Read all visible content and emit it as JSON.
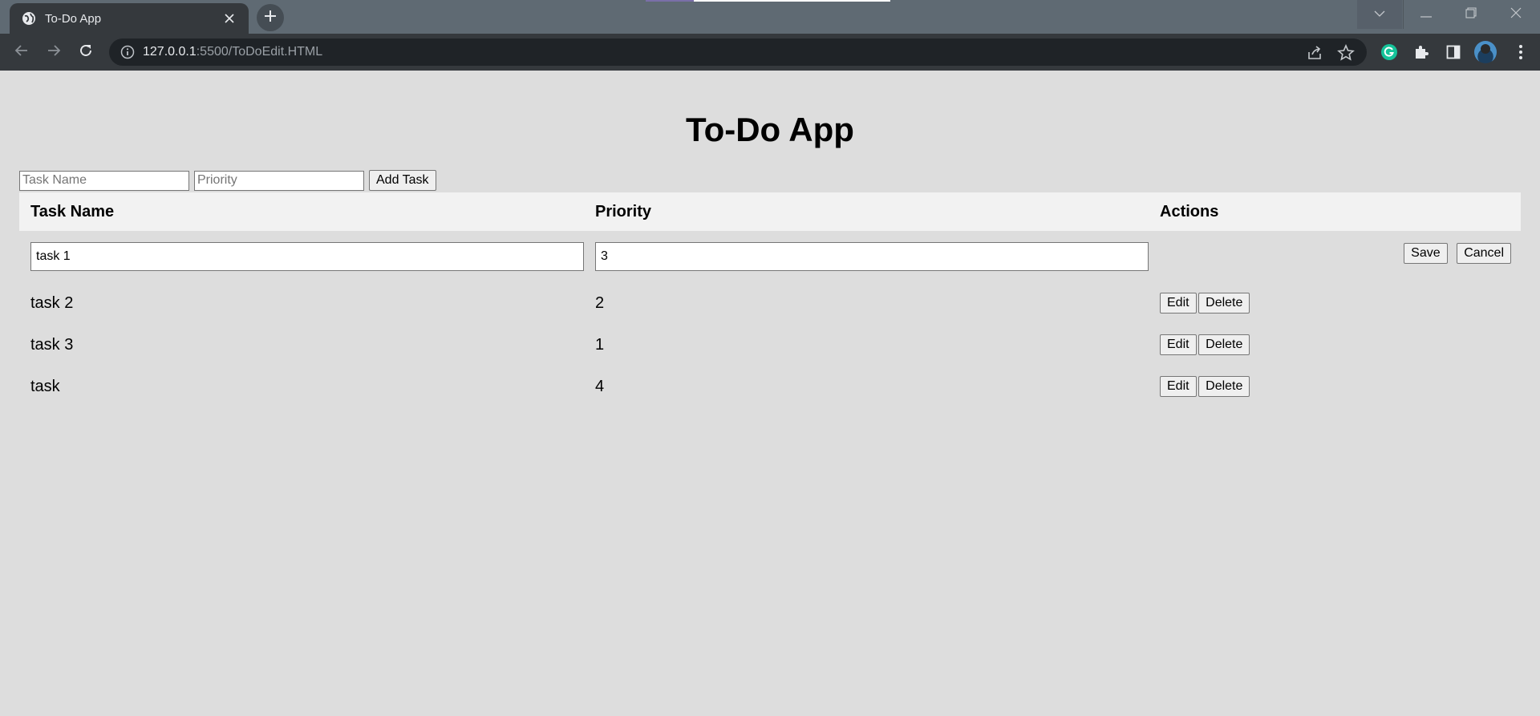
{
  "browser": {
    "tab_title": "To-Do App",
    "url_host": "127.0.0.1",
    "url_rest": ":5500/ToDoEdit.HTML"
  },
  "app": {
    "title": "To-Do App",
    "form": {
      "task_placeholder": "Task Name",
      "priority_placeholder": "Priority",
      "add_label": "Add Task"
    },
    "table": {
      "headers": [
        "Task Name",
        "Priority",
        "Actions"
      ],
      "edit_row": {
        "task_value": "task 1",
        "priority_value": "3",
        "save_label": "Save",
        "cancel_label": "Cancel"
      },
      "rows": [
        {
          "task": "task 2",
          "priority": "2",
          "edit_label": "Edit",
          "delete_label": "Delete"
        },
        {
          "task": "task 3",
          "priority": "1",
          "edit_label": "Edit",
          "delete_label": "Delete"
        },
        {
          "task": "task",
          "priority": "4",
          "edit_label": "Edit",
          "delete_label": "Delete"
        }
      ]
    }
  },
  "icons": {
    "tab": "globe-icon",
    "close_tab": "close-icon",
    "new_tab": "plus-icon",
    "back": "arrow-left-icon",
    "forward": "arrow-right-icon",
    "reload": "reload-icon",
    "site_info": "info-icon",
    "share": "share-icon",
    "bookmark": "star-icon",
    "grammarly": "grammarly-icon",
    "extensions": "puzzle-icon",
    "side_panel": "side-panel-icon",
    "profile": "avatar",
    "menu": "kebab-menu-icon"
  },
  "colors": {
    "page_bg": "#dddddd",
    "header_row_bg": "#f2f2f2",
    "grammarly": "#15c39a"
  }
}
